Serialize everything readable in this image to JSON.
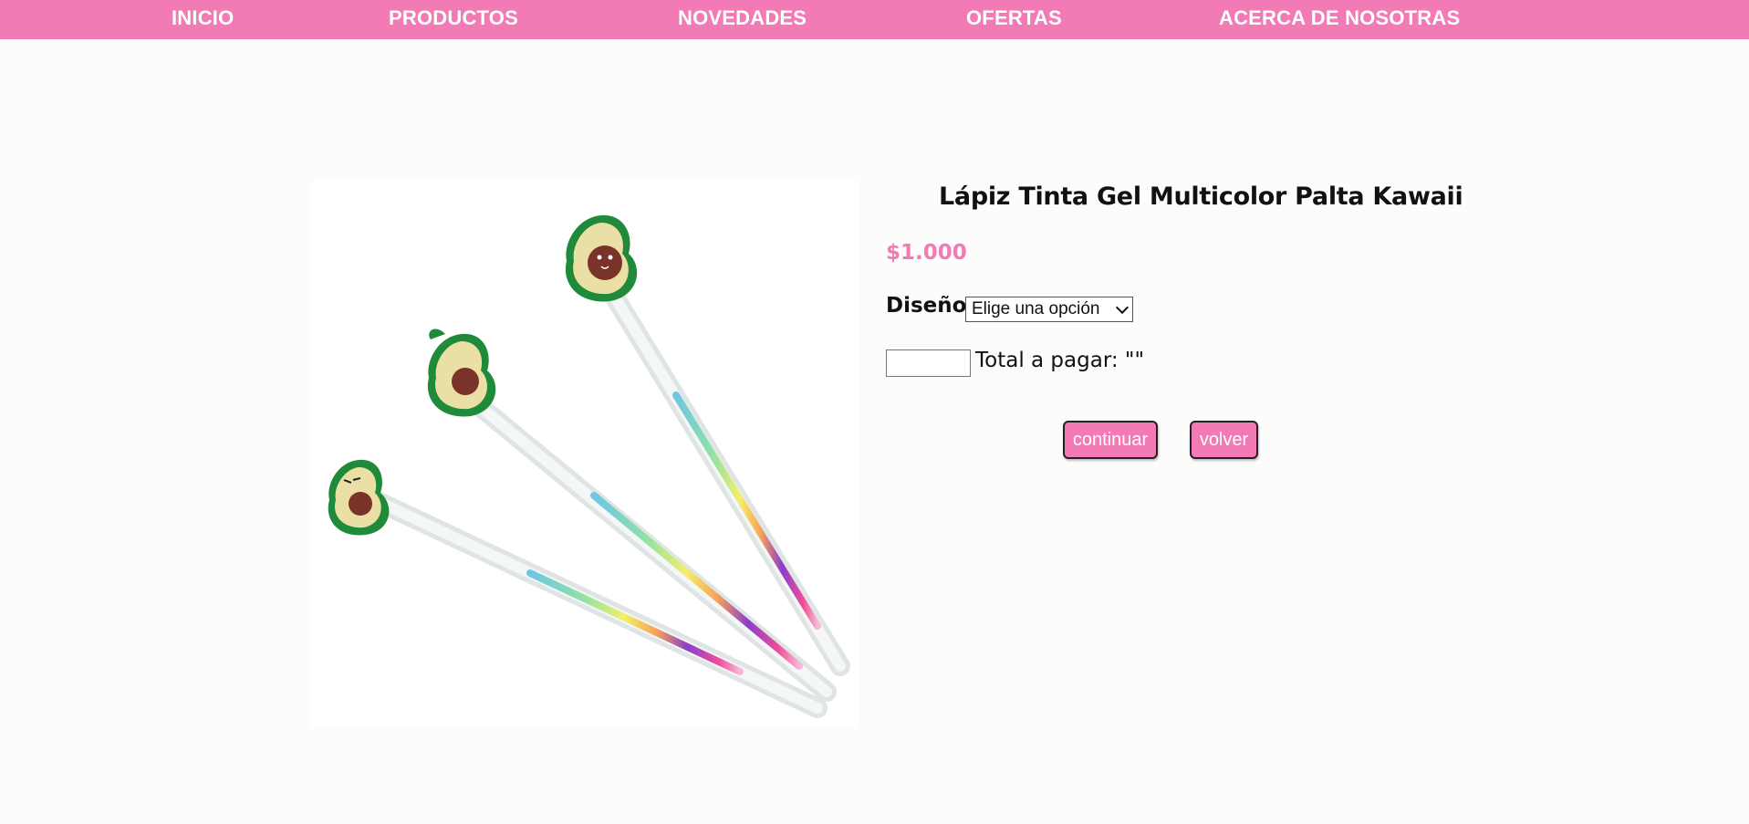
{
  "nav": {
    "items": [
      {
        "label": "INICIO"
      },
      {
        "label": "PRODUCTOS"
      },
      {
        "label": "NOVEDADES"
      },
      {
        "label": "OFERTAS"
      },
      {
        "label": "ACERCA DE NOSOTRAS"
      }
    ]
  },
  "product": {
    "title": "Lápiz Tinta Gel Multicolor Palta Kawaii",
    "price": "$1.000",
    "design_label": "Diseño:",
    "design_selected": "Elige una opción",
    "quantity_value": "",
    "total_label": "Total a pagar: \"\""
  },
  "actions": {
    "continue_label": "continuar",
    "back_label": "volver"
  },
  "colors": {
    "brand_pink": "#f27ab5",
    "background": "#fcfcfc",
    "avocado_green": "#1e8a3a"
  }
}
